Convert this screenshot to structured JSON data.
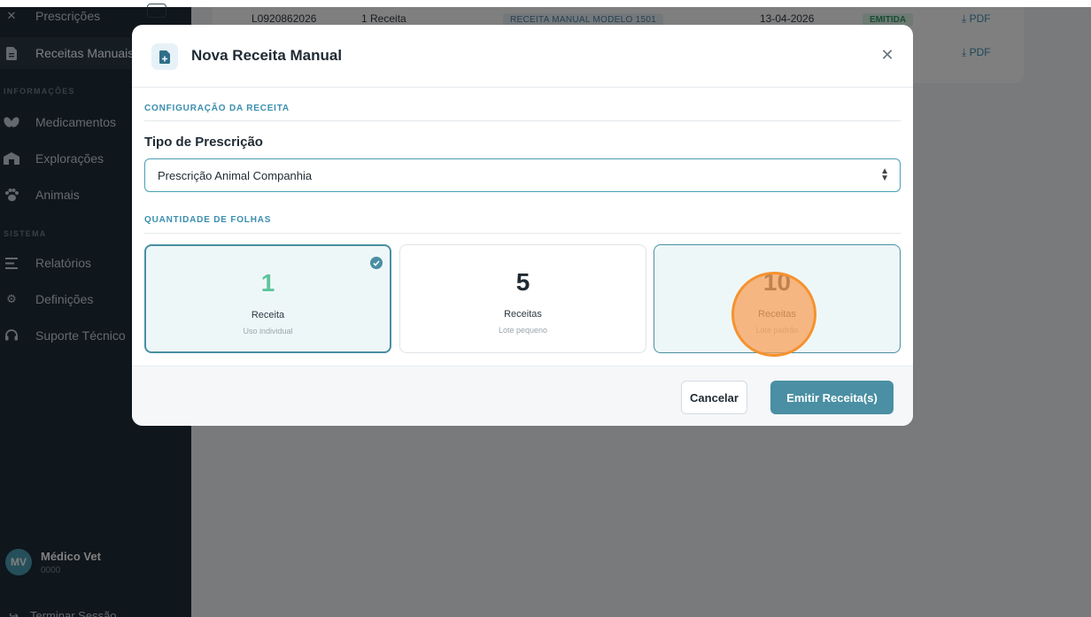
{
  "sidebar": {
    "items": [
      {
        "label": "Prescrições",
        "icon": "close-icon"
      },
      {
        "label": "Receitas Manuais",
        "icon": "document-icon"
      },
      {
        "label": "Medicamentos",
        "icon": "pills-icon"
      },
      {
        "label": "Explorações",
        "icon": "barn-icon"
      },
      {
        "label": "Animais",
        "icon": "paw-icon"
      },
      {
        "label": "Relatórios",
        "icon": "list-icon"
      },
      {
        "label": "Definições",
        "icon": "gear-icon"
      },
      {
        "label": "Suporte Técnico",
        "icon": "headset-icon"
      }
    ],
    "sections": [
      "INFORMAÇÕES",
      "SISTEMA"
    ],
    "user": {
      "initials": "MV",
      "name": "Médico Vet",
      "id": "0000"
    },
    "logout_label": "Terminar Sessão"
  },
  "table": {
    "rows": [
      {
        "code": "L0920862026",
        "count": "1 Receita",
        "type": "RECEITA MANUAL MODELO 1501",
        "date": "13-04-2026",
        "status": "EMITIDA",
        "action": "PDF"
      },
      {
        "code": "",
        "count": "",
        "type": "",
        "date": "",
        "status": "",
        "action": "PDF"
      }
    ]
  },
  "modal": {
    "title": "Nova Receita Manual",
    "section_config": "CONFIGURAÇÃO DA RECEITA",
    "prescription_type_label": "Tipo de Prescrição",
    "prescription_type_value": "Prescrição Animal Companhia",
    "section_quantity": "QUANTIDADE DE FOLHAS",
    "options": [
      {
        "number": "1",
        "label": "Receita",
        "sub": "Uso individual",
        "selected": true
      },
      {
        "number": "5",
        "label": "Receitas",
        "sub": "Lote pequeno",
        "selected": false
      },
      {
        "number": "10",
        "label": "Receitas",
        "sub": "Lote padrão",
        "selected": false
      }
    ],
    "cancel_label": "Cancelar",
    "submit_label": "Emitir Receita(s)"
  },
  "colors": {
    "accent": "#4a8fa3",
    "selected_number": "#5ec49a",
    "sidebar_bg": "#1f2d38",
    "cursor_highlight": "#f5922f"
  }
}
